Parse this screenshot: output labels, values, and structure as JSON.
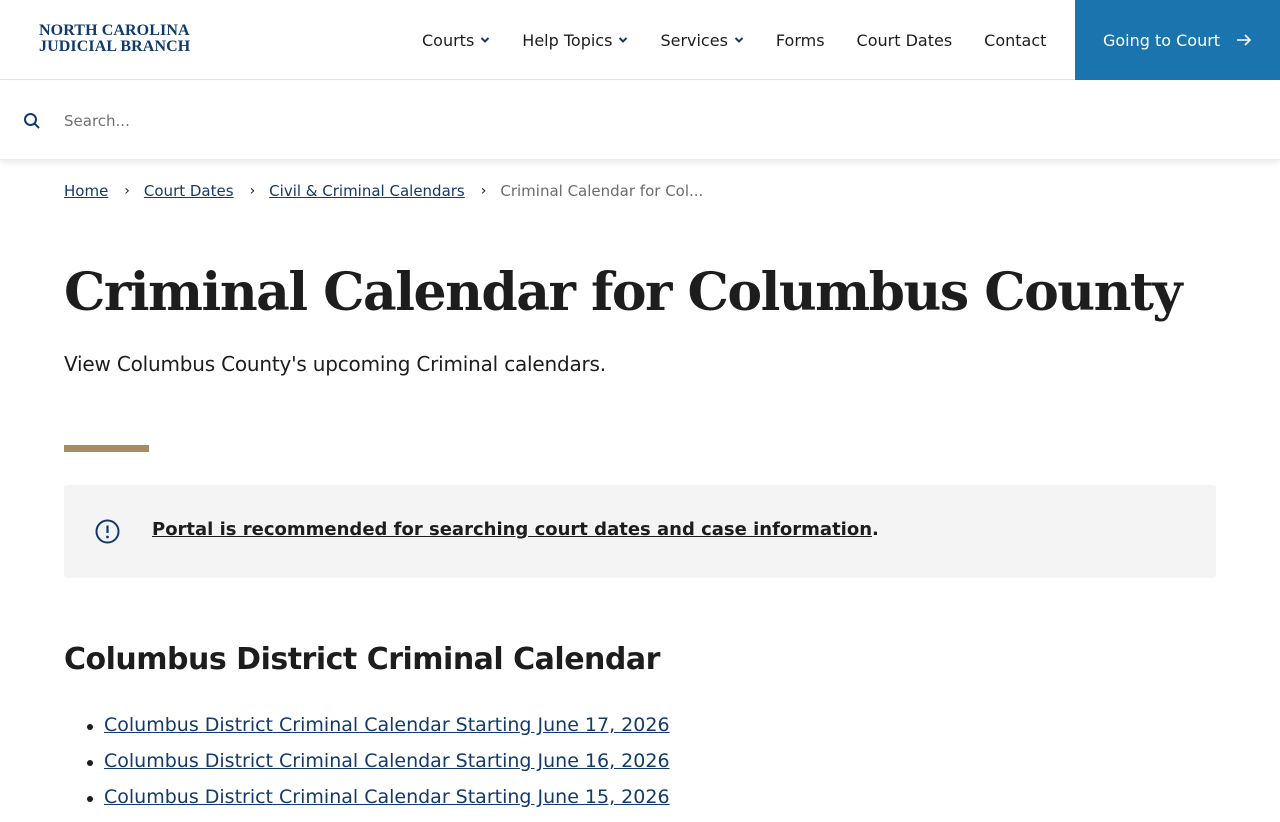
{
  "header": {
    "logo_line1": "NORTH CAROLINA",
    "logo_line2": "JUDICIAL BRANCH",
    "nav": [
      {
        "label": "Courts"
      },
      {
        "label": "Help Topics"
      },
      {
        "label": "Services"
      },
      {
        "label": "Forms"
      },
      {
        "label": "Court Dates"
      },
      {
        "label": "Contact"
      }
    ],
    "cta_label": "Going to Court",
    "cta_color": "#1a74ae"
  },
  "search": {
    "placeholder": "Search..."
  },
  "breadcrumb": {
    "items": [
      "Home",
      "Court Dates",
      "Civil & Criminal Calendars"
    ],
    "current": "Criminal Calendar for Col..."
  },
  "page": {
    "title": "Criminal Calendar for Columbus County",
    "subtitle": "View Columbus County's upcoming Criminal calendars.",
    "accent_color": "#a48d63"
  },
  "alert": {
    "link_text": "Portal is recommended for searching court dates and case information",
    "trailing": "."
  },
  "section": {
    "title": "Columbus District Criminal Calendar",
    "links": [
      "Columbus District Criminal Calendar Starting June 17, 2026",
      "Columbus District Criminal Calendar Starting June 16, 2026",
      "Columbus District Criminal Calendar Starting June 15, 2026"
    ]
  }
}
